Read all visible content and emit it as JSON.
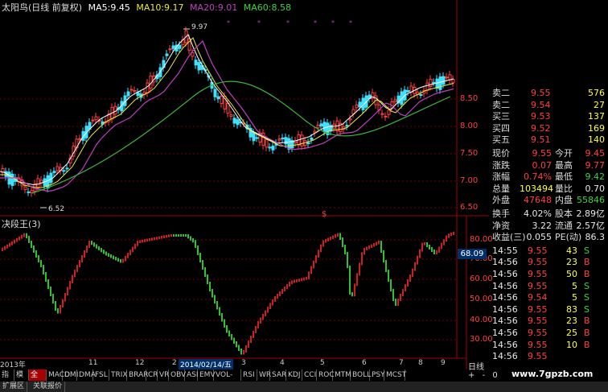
{
  "header": {
    "stock": "太阳鸟(日线 前复权)",
    "ma5_label": "MA5:",
    "ma5": "9.45",
    "ma10_label": "MA10:",
    "ma10": "9.17",
    "ma20_label": "MA20:",
    "ma20": "9.01",
    "ma60_label": "MA60:",
    "ma60": "8.58"
  },
  "price_chart": {
    "high_label": "9.97",
    "low_label": "6.52",
    "y_ticks": [
      "8.50",
      "8.00",
      "7.50",
      "7.00",
      "6.50"
    ]
  },
  "indicator": {
    "title": "决段王(3)",
    "y_ticks": [
      "80.00",
      "70.00",
      "60.00",
      "50.00",
      "40.00",
      "30.00",
      "20.00"
    ],
    "value_tag": "68.09",
    "marker": "$"
  },
  "timeline": {
    "labels": [
      "2013年",
      "11",
      "12",
      "2",
      "2014/02/14/五",
      "3",
      "4",
      "5",
      "6",
      "7",
      "8",
      "9"
    ]
  },
  "quote": {
    "sells": [
      {
        "label": "卖二",
        "price": "9.55",
        "vol": "576"
      },
      {
        "label": "卖二",
        "price": "9.54",
        "vol": "27"
      },
      {
        "label": "买三",
        "price": "9.53",
        "vol": "137"
      },
      {
        "label": "买四",
        "price": "9.52",
        "vol": "169"
      },
      {
        "label": "买五",
        "price": "9.51",
        "vol": "140"
      }
    ],
    "stats": [
      {
        "l1": "现价",
        "v1": "9.55",
        "l2": "今开",
        "v2": "9.45"
      },
      {
        "l1": "涨跌",
        "v1": "0.07",
        "l2": "最高",
        "v2": "9.77"
      },
      {
        "l1": "涨幅",
        "v1": "0.74%",
        "l2": "最低",
        "v2": "9.42"
      },
      {
        "l1": "总量",
        "v1": "103494",
        "l2": "量比",
        "v2": "0.70"
      },
      {
        "l1": "外盘",
        "v1": "47648",
        "l2": "内盘",
        "v2": "55846"
      }
    ],
    "stats2": [
      {
        "l1": "换手",
        "v1": "4.02%",
        "l2": "股本",
        "v2": "2.89亿"
      },
      {
        "l1": "净资",
        "v1": "3.22",
        "l2": "流通",
        "v2": "2.57亿"
      },
      {
        "l1": "收益(三)",
        "v1": "0.055",
        "l2": "PE(动)",
        "v2": "86.3"
      }
    ],
    "ticks": [
      {
        "t": "14:55",
        "p": "9.55",
        "v": "43",
        "s": "S"
      },
      {
        "t": "14:56",
        "p": "9.55",
        "v": "23",
        "s": "B"
      },
      {
        "t": "14:56",
        "p": "9.55",
        "v": "50",
        "s": "B"
      },
      {
        "t": "14:56",
        "p": "9.55",
        "v": "5",
        "s": "S"
      },
      {
        "t": "14:56",
        "p": "9.54",
        "v": "5",
        "s": "S"
      },
      {
        "t": "14:56",
        "p": "9.55",
        "v": "83",
        "s": "S"
      },
      {
        "t": "14:56",
        "p": "9.55",
        "v": "23",
        "s": "B"
      },
      {
        "t": "14:56",
        "p": "9.55",
        "v": "25",
        "s": "B"
      },
      {
        "t": "14:56",
        "p": "9.55",
        "v": "10",
        "s": "B"
      },
      {
        "t": "14:56",
        "p": "9.55",
        "v": "",
        "s": ""
      }
    ]
  },
  "tabs": [
    "指标",
    "模板",
    "全部",
    "MACD",
    "DMI",
    "DMA",
    "FSL",
    "TRIX",
    "BRAR",
    "CR",
    "VR",
    "OBV",
    "ASI",
    "EMV",
    "VOL-TDX",
    "RSI",
    "WR",
    "SAR",
    "KDJ",
    "CCI",
    "ROC",
    "MTM",
    "BOLL",
    "PSY",
    "MCST"
  ],
  "period": "日线",
  "controls": [
    "+",
    "-",
    "0"
  ],
  "bottom_tabs": [
    "扩展区",
    "关联报价"
  ],
  "watermark": "www.7gpzb.com"
}
